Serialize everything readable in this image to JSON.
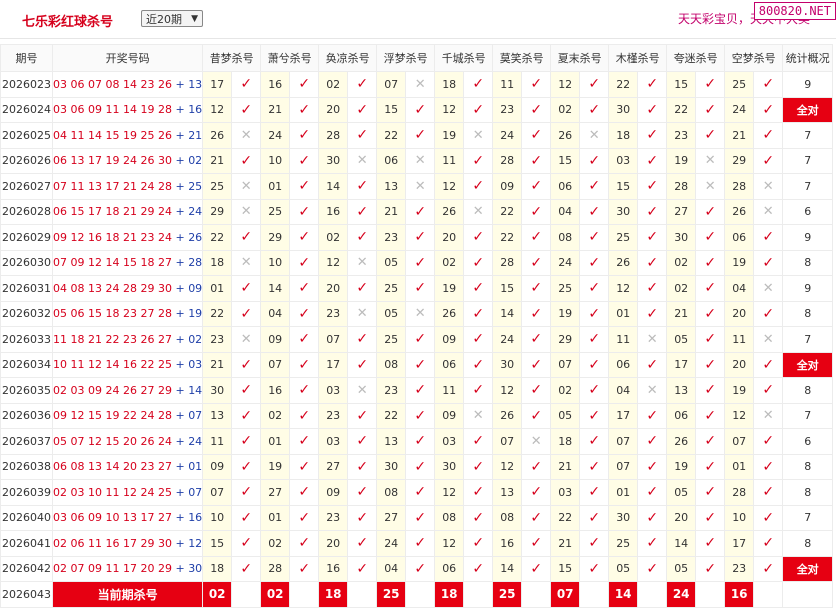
{
  "header": {
    "title": "七乐彩红球杀号",
    "select_value": "近20期",
    "slogan": "天天彩宝贝，天天中大奖",
    "watermark": "800820.NET"
  },
  "columns": {
    "period": "期号",
    "numbers": "开奖号码",
    "experts": [
      "昔梦杀号",
      "萧兮杀号",
      "奂凉杀号",
      "浮梦杀号",
      "千城杀号",
      "莫笑杀号",
      "夏末杀号",
      "木槿杀号",
      "夸迷杀号",
      "空梦杀号"
    ],
    "stat": "统计概况"
  },
  "rows": [
    {
      "p": "2026023",
      "n": "03 06 07 08 14 23 26",
      "s": "13",
      "k": [
        [
          "17",
          1
        ],
        [
          "16",
          1
        ],
        [
          "02",
          1
        ],
        [
          "07",
          0
        ],
        [
          "18",
          1
        ],
        [
          "11",
          1
        ],
        [
          "12",
          1
        ],
        [
          "22",
          1
        ],
        [
          "15",
          1
        ],
        [
          "25",
          1
        ]
      ],
      "stat": "9"
    },
    {
      "p": "2026024",
      "n": "03 06 09 11 14 19 28",
      "s": "16",
      "k": [
        [
          "12",
          1
        ],
        [
          "21",
          1
        ],
        [
          "20",
          1
        ],
        [
          "15",
          1
        ],
        [
          "12",
          1
        ],
        [
          "23",
          1
        ],
        [
          "02",
          1
        ],
        [
          "30",
          1
        ],
        [
          "22",
          1
        ],
        [
          "24",
          1
        ]
      ],
      "stat": "全对"
    },
    {
      "p": "2026025",
      "n": "04 11 14 15 19 25 26",
      "s": "21",
      "k": [
        [
          "26",
          0
        ],
        [
          "24",
          1
        ],
        [
          "28",
          1
        ],
        [
          "22",
          1
        ],
        [
          "19",
          0
        ],
        [
          "24",
          1
        ],
        [
          "26",
          0
        ],
        [
          "18",
          1
        ],
        [
          "23",
          1
        ],
        [
          "21",
          1
        ]
      ],
      "stat": "7"
    },
    {
      "p": "2026026",
      "n": "06 13 17 19 24 26 30",
      "s": "02",
      "k": [
        [
          "21",
          1
        ],
        [
          "10",
          1
        ],
        [
          "30",
          0
        ],
        [
          "06",
          0
        ],
        [
          "11",
          1
        ],
        [
          "28",
          1
        ],
        [
          "15",
          1
        ],
        [
          "03",
          1
        ],
        [
          "19",
          0
        ],
        [
          "29",
          1
        ]
      ],
      "stat": "7"
    },
    {
      "p": "2026027",
      "n": "07 11 13 17 21 24 28",
      "s": "25",
      "k": [
        [
          "25",
          0
        ],
        [
          "01",
          1
        ],
        [
          "14",
          1
        ],
        [
          "13",
          0
        ],
        [
          "12",
          1
        ],
        [
          "09",
          1
        ],
        [
          "06",
          1
        ],
        [
          "15",
          1
        ],
        [
          "28",
          0
        ],
        [
          "28",
          0
        ]
      ],
      "stat": "7"
    },
    {
      "p": "2026028",
      "n": "06 15 17 18 21 29 24",
      "s": "24",
      "k": [
        [
          "29",
          0
        ],
        [
          "25",
          1
        ],
        [
          "16",
          1
        ],
        [
          "21",
          1
        ],
        [
          "26",
          0
        ],
        [
          "22",
          1
        ],
        [
          "04",
          1
        ],
        [
          "30",
          1
        ],
        [
          "27",
          1
        ],
        [
          "26",
          0
        ]
      ],
      "stat": "6"
    },
    {
      "p": "2026029",
      "n": "09 12 16 18 21 23 24",
      "s": "26",
      "k": [
        [
          "22",
          1
        ],
        [
          "29",
          1
        ],
        [
          "02",
          1
        ],
        [
          "23",
          1
        ],
        [
          "20",
          1
        ],
        [
          "22",
          1
        ],
        [
          "08",
          1
        ],
        [
          "25",
          1
        ],
        [
          "30",
          1
        ],
        [
          "06",
          1
        ]
      ],
      "stat": "9"
    },
    {
      "p": "2026030",
      "n": "07 09 12 14 15 18 27",
      "s": "28",
      "k": [
        [
          "18",
          0
        ],
        [
          "10",
          1
        ],
        [
          "12",
          0
        ],
        [
          "05",
          1
        ],
        [
          "02",
          1
        ],
        [
          "28",
          1
        ],
        [
          "24",
          1
        ],
        [
          "26",
          1
        ],
        [
          "02",
          1
        ],
        [
          "19",
          1
        ]
      ],
      "stat": "8"
    },
    {
      "p": "2026031",
      "n": "04 08 13 24 28 29 30",
      "s": "09",
      "k": [
        [
          "01",
          1
        ],
        [
          "14",
          1
        ],
        [
          "20",
          1
        ],
        [
          "25",
          1
        ],
        [
          "19",
          1
        ],
        [
          "15",
          1
        ],
        [
          "25",
          1
        ],
        [
          "12",
          1
        ],
        [
          "02",
          1
        ],
        [
          "04",
          0
        ]
      ],
      "stat": "9"
    },
    {
      "p": "2026032",
      "n": "05 06 15 18 23 27 28",
      "s": "19",
      "k": [
        [
          "22",
          1
        ],
        [
          "04",
          1
        ],
        [
          "23",
          0
        ],
        [
          "05",
          0
        ],
        [
          "26",
          1
        ],
        [
          "14",
          1
        ],
        [
          "19",
          1
        ],
        [
          "01",
          1
        ],
        [
          "21",
          1
        ],
        [
          "20",
          1
        ]
      ],
      "stat": "8"
    },
    {
      "p": "2026033",
      "n": "11 18 21 22 23 26 27",
      "s": "02",
      "k": [
        [
          "23",
          0
        ],
        [
          "09",
          1
        ],
        [
          "07",
          1
        ],
        [
          "25",
          1
        ],
        [
          "09",
          1
        ],
        [
          "24",
          1
        ],
        [
          "29",
          1
        ],
        [
          "11",
          0
        ],
        [
          "05",
          1
        ],
        [
          "11",
          0
        ]
      ],
      "stat": "7"
    },
    {
      "p": "2026034",
      "n": "10 11 12 14 16 22 25",
      "s": "03",
      "k": [
        [
          "21",
          1
        ],
        [
          "07",
          1
        ],
        [
          "17",
          1
        ],
        [
          "08",
          1
        ],
        [
          "06",
          1
        ],
        [
          "30",
          1
        ],
        [
          "07",
          1
        ],
        [
          "06",
          1
        ],
        [
          "17",
          1
        ],
        [
          "20",
          1
        ]
      ],
      "stat": "全对"
    },
    {
      "p": "2026035",
      "n": "02 03 09 24 26 27 29",
      "s": "14",
      "k": [
        [
          "30",
          1
        ],
        [
          "16",
          1
        ],
        [
          "03",
          0
        ],
        [
          "23",
          1
        ],
        [
          "11",
          1
        ],
        [
          "12",
          1
        ],
        [
          "02",
          1
        ],
        [
          "04",
          0
        ],
        [
          "13",
          1
        ],
        [
          "19",
          1
        ]
      ],
      "stat": "8"
    },
    {
      "p": "2026036",
      "n": "09 12 15 19 22 24 28",
      "s": "07",
      "k": [
        [
          "13",
          1
        ],
        [
          "02",
          1
        ],
        [
          "23",
          1
        ],
        [
          "22",
          1
        ],
        [
          "09",
          0
        ],
        [
          "26",
          1
        ],
        [
          "05",
          1
        ],
        [
          "17",
          1
        ],
        [
          "06",
          1
        ],
        [
          "12",
          0
        ]
      ],
      "stat": "7"
    },
    {
      "p": "2026037",
      "n": "05 07 12 15 20 26 24",
      "s": "24",
      "k": [
        [
          "11",
          1
        ],
        [
          "01",
          1
        ],
        [
          "03",
          1
        ],
        [
          "13",
          1
        ],
        [
          "03",
          1
        ],
        [
          "07",
          0
        ],
        [
          "18",
          1
        ],
        [
          "07",
          1
        ],
        [
          "26",
          1
        ],
        [
          "07",
          1
        ]
      ],
      "stat": "6"
    },
    {
      "p": "2026038",
      "n": "06 08 13 14 20 23 27",
      "s": "01",
      "k": [
        [
          "09",
          1
        ],
        [
          "19",
          1
        ],
        [
          "27",
          1
        ],
        [
          "30",
          1
        ],
        [
          "30",
          1
        ],
        [
          "12",
          1
        ],
        [
          "21",
          1
        ],
        [
          "07",
          1
        ],
        [
          "19",
          1
        ],
        [
          "01",
          1
        ]
      ],
      "stat": "8"
    },
    {
      "p": "2026039",
      "n": "02 03 10 11 12 24 25",
      "s": "07",
      "k": [
        [
          "07",
          1
        ],
        [
          "27",
          1
        ],
        [
          "09",
          1
        ],
        [
          "08",
          1
        ],
        [
          "12",
          1
        ],
        [
          "13",
          1
        ],
        [
          "03",
          1
        ],
        [
          "01",
          1
        ],
        [
          "05",
          1
        ],
        [
          "28",
          1
        ]
      ],
      "stat": "8"
    },
    {
      "p": "2026040",
      "n": "03 06 09 10 13 17 27",
      "s": "16",
      "k": [
        [
          "10",
          1
        ],
        [
          "01",
          1
        ],
        [
          "23",
          1
        ],
        [
          "27",
          1
        ],
        [
          "08",
          1
        ],
        [
          "08",
          1
        ],
        [
          "22",
          1
        ],
        [
          "30",
          1
        ],
        [
          "20",
          1
        ],
        [
          "10",
          1
        ]
      ],
      "stat": "7"
    },
    {
      "p": "2026041",
      "n": "02 06 11 16 17 29 30",
      "s": "12",
      "k": [
        [
          "15",
          1
        ],
        [
          "02",
          1
        ],
        [
          "20",
          1
        ],
        [
          "24",
          1
        ],
        [
          "12",
          1
        ],
        [
          "16",
          1
        ],
        [
          "21",
          1
        ],
        [
          "25",
          1
        ],
        [
          "14",
          1
        ],
        [
          "17",
          1
        ]
      ],
      "stat": "8"
    },
    {
      "p": "2026042",
      "n": "02 07 09 11 17 20 29",
      "s": "30",
      "k": [
        [
          "18",
          1
        ],
        [
          "28",
          1
        ],
        [
          "16",
          1
        ],
        [
          "04",
          1
        ],
        [
          "06",
          1
        ],
        [
          "14",
          1
        ],
        [
          "15",
          1
        ],
        [
          "05",
          1
        ],
        [
          "05",
          1
        ],
        [
          "23",
          1
        ]
      ],
      "stat": "全对"
    }
  ],
  "current": {
    "p": "2026043",
    "label": "当前期杀号",
    "kills": [
      "02",
      "02",
      "18",
      "25",
      "18",
      "25",
      "07",
      "14",
      "24",
      "16"
    ]
  },
  "icons": {
    "right": "check-icon",
    "wrong": "cross-icon"
  },
  "colors": {
    "red": "#d6001c",
    "blue": "#1f3fa8",
    "highlight": "#fffde6",
    "badge": "#e60012"
  }
}
